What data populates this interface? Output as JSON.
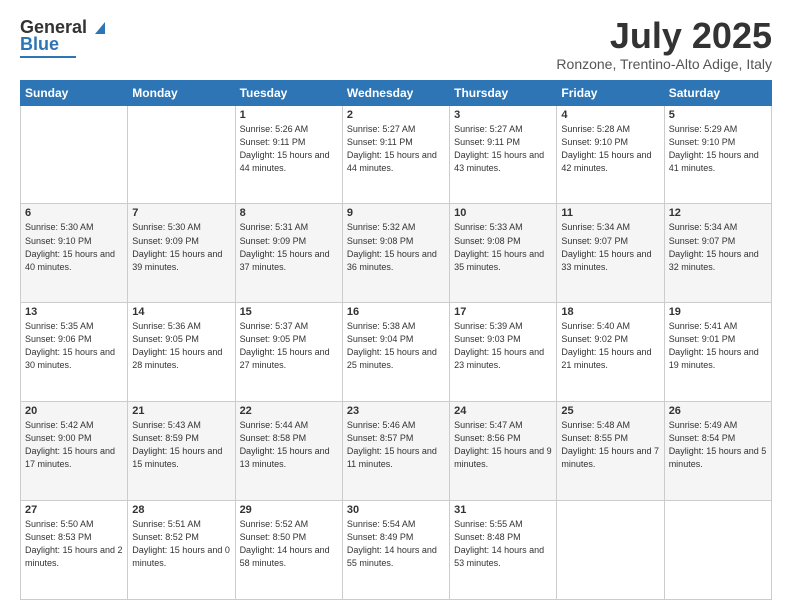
{
  "header": {
    "logo_general": "General",
    "logo_blue": "Blue",
    "month_title": "July 2025",
    "location": "Ronzone, Trentino-Alto Adige, Italy"
  },
  "weekdays": [
    "Sunday",
    "Monday",
    "Tuesday",
    "Wednesday",
    "Thursday",
    "Friday",
    "Saturday"
  ],
  "weeks": [
    [
      {
        "day": "",
        "sunrise": "",
        "sunset": "",
        "daylight": ""
      },
      {
        "day": "",
        "sunrise": "",
        "sunset": "",
        "daylight": ""
      },
      {
        "day": "1",
        "sunrise": "Sunrise: 5:26 AM",
        "sunset": "Sunset: 9:11 PM",
        "daylight": "Daylight: 15 hours and 44 minutes."
      },
      {
        "day": "2",
        "sunrise": "Sunrise: 5:27 AM",
        "sunset": "Sunset: 9:11 PM",
        "daylight": "Daylight: 15 hours and 44 minutes."
      },
      {
        "day": "3",
        "sunrise": "Sunrise: 5:27 AM",
        "sunset": "Sunset: 9:11 PM",
        "daylight": "Daylight: 15 hours and 43 minutes."
      },
      {
        "day": "4",
        "sunrise": "Sunrise: 5:28 AM",
        "sunset": "Sunset: 9:10 PM",
        "daylight": "Daylight: 15 hours and 42 minutes."
      },
      {
        "day": "5",
        "sunrise": "Sunrise: 5:29 AM",
        "sunset": "Sunset: 9:10 PM",
        "daylight": "Daylight: 15 hours and 41 minutes."
      }
    ],
    [
      {
        "day": "6",
        "sunrise": "Sunrise: 5:30 AM",
        "sunset": "Sunset: 9:10 PM",
        "daylight": "Daylight: 15 hours and 40 minutes."
      },
      {
        "day": "7",
        "sunrise": "Sunrise: 5:30 AM",
        "sunset": "Sunset: 9:09 PM",
        "daylight": "Daylight: 15 hours and 39 minutes."
      },
      {
        "day": "8",
        "sunrise": "Sunrise: 5:31 AM",
        "sunset": "Sunset: 9:09 PM",
        "daylight": "Daylight: 15 hours and 37 minutes."
      },
      {
        "day": "9",
        "sunrise": "Sunrise: 5:32 AM",
        "sunset": "Sunset: 9:08 PM",
        "daylight": "Daylight: 15 hours and 36 minutes."
      },
      {
        "day": "10",
        "sunrise": "Sunrise: 5:33 AM",
        "sunset": "Sunset: 9:08 PM",
        "daylight": "Daylight: 15 hours and 35 minutes."
      },
      {
        "day": "11",
        "sunrise": "Sunrise: 5:34 AM",
        "sunset": "Sunset: 9:07 PM",
        "daylight": "Daylight: 15 hours and 33 minutes."
      },
      {
        "day": "12",
        "sunrise": "Sunrise: 5:34 AM",
        "sunset": "Sunset: 9:07 PM",
        "daylight": "Daylight: 15 hours and 32 minutes."
      }
    ],
    [
      {
        "day": "13",
        "sunrise": "Sunrise: 5:35 AM",
        "sunset": "Sunset: 9:06 PM",
        "daylight": "Daylight: 15 hours and 30 minutes."
      },
      {
        "day": "14",
        "sunrise": "Sunrise: 5:36 AM",
        "sunset": "Sunset: 9:05 PM",
        "daylight": "Daylight: 15 hours and 28 minutes."
      },
      {
        "day": "15",
        "sunrise": "Sunrise: 5:37 AM",
        "sunset": "Sunset: 9:05 PM",
        "daylight": "Daylight: 15 hours and 27 minutes."
      },
      {
        "day": "16",
        "sunrise": "Sunrise: 5:38 AM",
        "sunset": "Sunset: 9:04 PM",
        "daylight": "Daylight: 15 hours and 25 minutes."
      },
      {
        "day": "17",
        "sunrise": "Sunrise: 5:39 AM",
        "sunset": "Sunset: 9:03 PM",
        "daylight": "Daylight: 15 hours and 23 minutes."
      },
      {
        "day": "18",
        "sunrise": "Sunrise: 5:40 AM",
        "sunset": "Sunset: 9:02 PM",
        "daylight": "Daylight: 15 hours and 21 minutes."
      },
      {
        "day": "19",
        "sunrise": "Sunrise: 5:41 AM",
        "sunset": "Sunset: 9:01 PM",
        "daylight": "Daylight: 15 hours and 19 minutes."
      }
    ],
    [
      {
        "day": "20",
        "sunrise": "Sunrise: 5:42 AM",
        "sunset": "Sunset: 9:00 PM",
        "daylight": "Daylight: 15 hours and 17 minutes."
      },
      {
        "day": "21",
        "sunrise": "Sunrise: 5:43 AM",
        "sunset": "Sunset: 8:59 PM",
        "daylight": "Daylight: 15 hours and 15 minutes."
      },
      {
        "day": "22",
        "sunrise": "Sunrise: 5:44 AM",
        "sunset": "Sunset: 8:58 PM",
        "daylight": "Daylight: 15 hours and 13 minutes."
      },
      {
        "day": "23",
        "sunrise": "Sunrise: 5:46 AM",
        "sunset": "Sunset: 8:57 PM",
        "daylight": "Daylight: 15 hours and 11 minutes."
      },
      {
        "day": "24",
        "sunrise": "Sunrise: 5:47 AM",
        "sunset": "Sunset: 8:56 PM",
        "daylight": "Daylight: 15 hours and 9 minutes."
      },
      {
        "day": "25",
        "sunrise": "Sunrise: 5:48 AM",
        "sunset": "Sunset: 8:55 PM",
        "daylight": "Daylight: 15 hours and 7 minutes."
      },
      {
        "day": "26",
        "sunrise": "Sunrise: 5:49 AM",
        "sunset": "Sunset: 8:54 PM",
        "daylight": "Daylight: 15 hours and 5 minutes."
      }
    ],
    [
      {
        "day": "27",
        "sunrise": "Sunrise: 5:50 AM",
        "sunset": "Sunset: 8:53 PM",
        "daylight": "Daylight: 15 hours and 2 minutes."
      },
      {
        "day": "28",
        "sunrise": "Sunrise: 5:51 AM",
        "sunset": "Sunset: 8:52 PM",
        "daylight": "Daylight: 15 hours and 0 minutes."
      },
      {
        "day": "29",
        "sunrise": "Sunrise: 5:52 AM",
        "sunset": "Sunset: 8:50 PM",
        "daylight": "Daylight: 14 hours and 58 minutes."
      },
      {
        "day": "30",
        "sunrise": "Sunrise: 5:54 AM",
        "sunset": "Sunset: 8:49 PM",
        "daylight": "Daylight: 14 hours and 55 minutes."
      },
      {
        "day": "31",
        "sunrise": "Sunrise: 5:55 AM",
        "sunset": "Sunset: 8:48 PM",
        "daylight": "Daylight: 14 hours and 53 minutes."
      },
      {
        "day": "",
        "sunrise": "",
        "sunset": "",
        "daylight": ""
      },
      {
        "day": "",
        "sunrise": "",
        "sunset": "",
        "daylight": ""
      }
    ]
  ]
}
